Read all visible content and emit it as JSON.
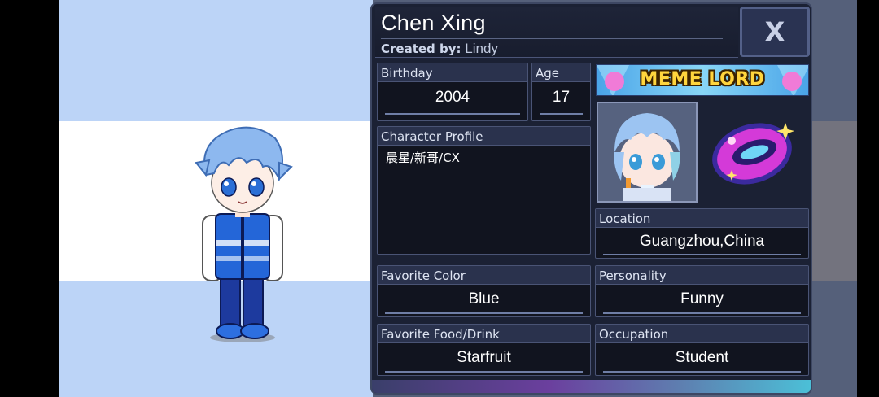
{
  "character": {
    "name": "Chen Xing",
    "created_by_label": "Created by:",
    "created_by": "Lindy"
  },
  "close_button": {
    "label": "X"
  },
  "fields": {
    "birthday": {
      "label": "Birthday",
      "value": "2004"
    },
    "age": {
      "label": "Age",
      "value": "17"
    },
    "profile": {
      "label": "Character Profile",
      "value": "晨星/新哥/CX"
    },
    "location": {
      "label": "Location",
      "value": "Guangzhou,China"
    },
    "favorite_color": {
      "label": "Favorite Color",
      "value": "Blue"
    },
    "personality": {
      "label": "Personality",
      "value": "Funny"
    },
    "favorite_food": {
      "label": "Favorite Food/Drink",
      "value": "Starfruit"
    },
    "occupation": {
      "label": "Occupation",
      "value": "Student"
    }
  },
  "banner": {
    "text": "MEME LORD"
  },
  "icons": {
    "portrait": "character-portrait-icon",
    "pet": "cosmic-pet-icon",
    "close": "close-icon"
  },
  "colors": {
    "panel_bg": "#1b2134",
    "header_bg": "#2a324d",
    "border": "#4a5475",
    "accent_banner": "#ffd53d",
    "background_band": "#bcd4f7"
  }
}
